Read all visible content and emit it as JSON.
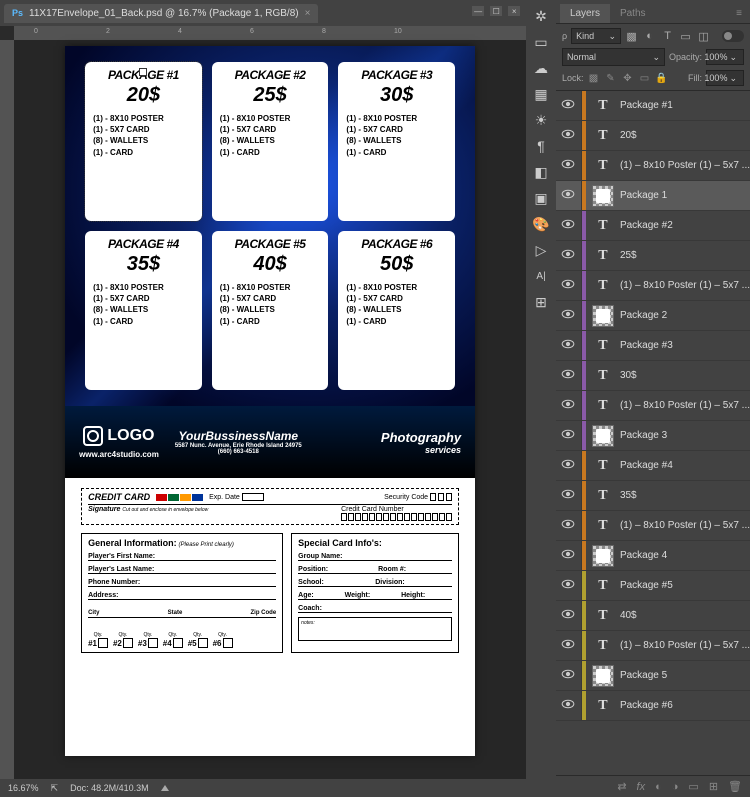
{
  "tab": {
    "title": "11X17Envelope_01_Back.psd @ 16.7% (Package 1, RGB/8)"
  },
  "ruler": {
    "marks": [
      "0",
      "2",
      "4",
      "6",
      "8",
      "10"
    ]
  },
  "status": {
    "zoom": "16.67%",
    "doc": "Doc: 48.2M/410.3M"
  },
  "canvas": {
    "packages": [
      {
        "title": "PACKAGE #1",
        "price": "20$",
        "items": [
          "(1) - 8X10 POSTER",
          "(1) - 5X7 CARD",
          "(8) - WALLETS",
          "(1) - CARD"
        ],
        "selected": true
      },
      {
        "title": "PACKAGE #2",
        "price": "25$",
        "items": [
          "(1) - 8X10 POSTER",
          "(1) - 5X7 CARD",
          "(8) - WALLETS",
          "(1) - CARD"
        ]
      },
      {
        "title": "PACKAGE #3",
        "price": "30$",
        "items": [
          "(1) - 8X10 POSTER",
          "(1) - 5X7 CARD",
          "(8) - WALLETS",
          "(1) - CARD"
        ]
      },
      {
        "title": "PACKAGE #4",
        "price": "35$",
        "items": [
          "(1) - 8X10 POSTER",
          "(1) - 5X7 CARD",
          "(8) - WALLETS",
          "(1) - CARD"
        ]
      },
      {
        "title": "PACKAGE #5",
        "price": "40$",
        "items": [
          "(1) - 8X10 POSTER",
          "(1) - 5X7 CARD",
          "(8) - WALLETS",
          "(1) - CARD"
        ]
      },
      {
        "title": "PACKAGE #6",
        "price": "50$",
        "items": [
          "(1) - 8X10 POSTER",
          "(1) - 5X7 CARD",
          "(8) - WALLETS",
          "(1) - CARD"
        ]
      }
    ],
    "footer": {
      "logo": "LOGO",
      "url": "www.arc4studio.com",
      "bizName": "YourBussinessName",
      "bizAddr": "5587 Nunc. Avenue, Erie Rhode Island 24975",
      "bizPhone": "(660) 663-4518",
      "service1": "Photography",
      "service2": "services"
    },
    "credit": {
      "title": "CREDIT CARD",
      "exp": "Exp. Date",
      "sec": "Security Code",
      "sig": "Signature",
      "cut": "Cut out and enclose in envelope below",
      "ccnum": "Credit Card Number"
    },
    "info": {
      "genTitle": "General Information:",
      "genNote": "(Please Print clearly)",
      "first": "Player's First Name:",
      "last": "Player's Last Name:",
      "phone": "Phone Number:",
      "addr": "Address:",
      "city": "City",
      "state": "State",
      "zip": "Zip Code",
      "qtyLabel": "Qty.",
      "qtys": [
        "#1",
        "#2",
        "#3",
        "#4",
        "#5",
        "#6"
      ],
      "cardTitle": "Special Card Info's:",
      "group": "Group Name:",
      "position": "Position:",
      "room": "Room #:",
      "school": "School:",
      "division": "Division:",
      "age": "Age:",
      "weight": "Weight:",
      "height": "Height:",
      "coach": "Coach:",
      "notes": "notes:"
    }
  },
  "panel": {
    "tabs": {
      "layers": "Layers",
      "paths": "Paths"
    },
    "kind": "Kind",
    "blend": "Normal",
    "opacityLabel": "Opacity:",
    "opacity": "100%",
    "lockLabel": "Lock:",
    "fillLabel": "Fill:",
    "fill": "100%"
  },
  "layers": [
    {
      "type": "text",
      "name": "Package #1",
      "color": "orange"
    },
    {
      "type": "text",
      "name": "20$",
      "color": "orange"
    },
    {
      "type": "text",
      "name": "(1) – 8x10 Poster (1) – 5x7 ...",
      "color": "orange"
    },
    {
      "type": "img",
      "name": "Package 1",
      "color": "orange",
      "selected": true
    },
    {
      "type": "text",
      "name": "Package #2",
      "color": "purple"
    },
    {
      "type": "text",
      "name": "25$",
      "color": "purple"
    },
    {
      "type": "text",
      "name": "(1) – 8x10 Poster (1) – 5x7 ...",
      "color": "purple"
    },
    {
      "type": "img",
      "name": "Package 2",
      "color": "purple"
    },
    {
      "type": "text",
      "name": "Package #3",
      "color": "purple"
    },
    {
      "type": "text",
      "name": "30$",
      "color": "purple"
    },
    {
      "type": "text",
      "name": "(1) – 8x10 Poster (1) – 5x7 ...",
      "color": "purple"
    },
    {
      "type": "img",
      "name": "Package 3",
      "color": "purple"
    },
    {
      "type": "text",
      "name": "Package #4",
      "color": "orange"
    },
    {
      "type": "text",
      "name": "35$",
      "color": "orange"
    },
    {
      "type": "text",
      "name": "(1) – 8x10 Poster (1) – 5x7 ...",
      "color": "orange"
    },
    {
      "type": "img",
      "name": "Package 4",
      "color": "orange"
    },
    {
      "type": "text",
      "name": "Package #5",
      "color": "yellow"
    },
    {
      "type": "text",
      "name": "40$",
      "color": "yellow"
    },
    {
      "type": "text",
      "name": "(1) – 8x10 Poster (1) – 5x7 ...",
      "color": "yellow"
    },
    {
      "type": "img",
      "name": "Package 5",
      "color": "yellow"
    },
    {
      "type": "text",
      "name": "Package #6",
      "color": "yellow"
    }
  ]
}
